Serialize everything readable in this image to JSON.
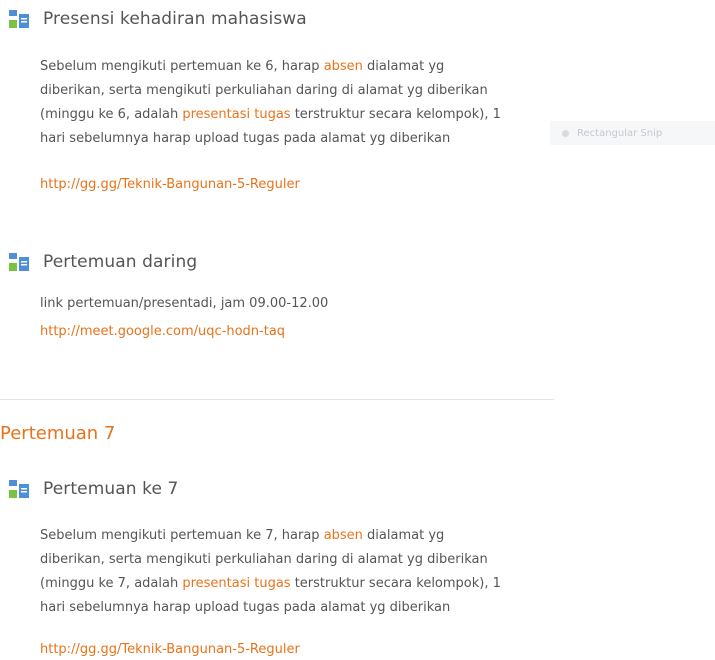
{
  "activities": [
    {
      "title": "Presensi kehadiran mahasiswa",
      "desc": [
        {
          "t": "Sebelum mengikuti pertemuan ke 6, harap "
        },
        {
          "t": "absen",
          "hl": true
        },
        {
          "t": " dialamat yg diberikan, serta mengikuti perkuliahan daring di alamat yg diberikan (minggu ke 6, adalah "
        },
        {
          "t": "presentasi tugas",
          "hl": true
        },
        {
          "t": " terstruktur secara kelompok), 1 hari sebelumnya harap upload tugas pada alamat yg diberikan"
        }
      ],
      "link": "http://gg.gg/Teknik-Bangunan-5-Reguler"
    },
    {
      "title": "Pertemuan daring",
      "desc": [
        {
          "t": "link pertemuan/presentadi, jam 09.00-12.00"
        }
      ],
      "link": "http://meet.google.com/uqc-hodn-taq"
    },
    {
      "title": "Pertemuan ke 7",
      "desc": [
        {
          "t": "Sebelum mengikuti pertemuan ke 7, harap "
        },
        {
          "t": "absen",
          "hl": true
        },
        {
          "t": " dialamat yg diberikan, serta mengikuti perkuliahan daring di alamat yg diberikan (minggu ke 7, adalah "
        },
        {
          "t": "presentasi tugas",
          "hl": true
        },
        {
          "t": " terstruktur secara kelompok), 1 hari sebelumnya harap upload tugas pada alamat yg diberikan"
        }
      ],
      "link": "http://gg.gg/Teknik-Bangunan-5-Reguler"
    }
  ],
  "section_title": "Pertemuan 7",
  "snip_label": "Rectangular Snip",
  "colors": {
    "accent": "#e8731a",
    "text": "#555555",
    "icon_blue": "#4f8fd6",
    "icon_green": "#7cc242"
  }
}
